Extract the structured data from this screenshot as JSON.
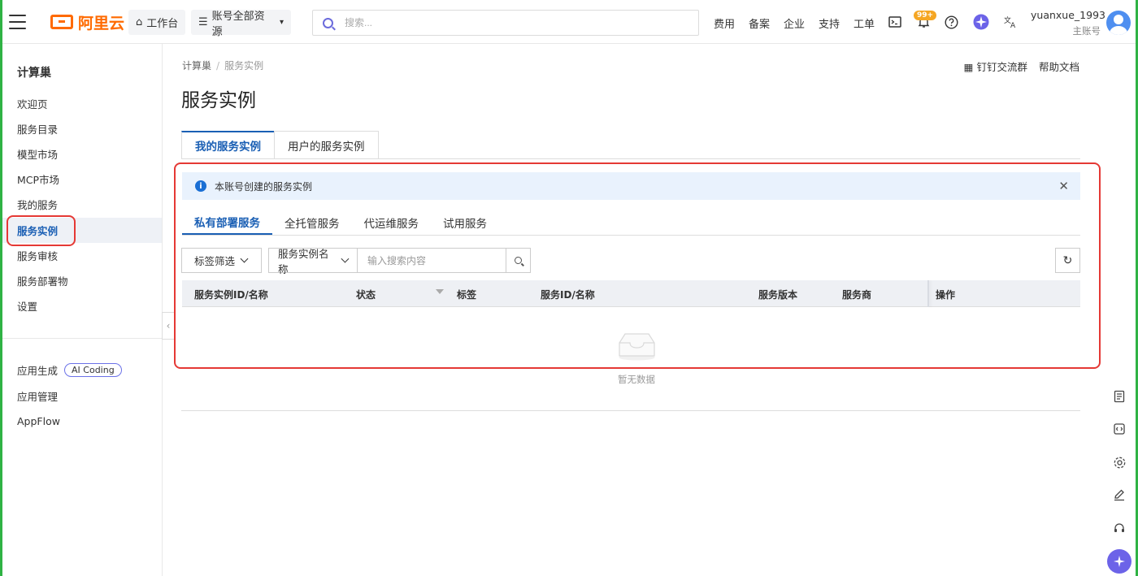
{
  "topbar": {
    "logo_text": "阿里云",
    "workbench_label": "工作台",
    "resource_label": "账号全部资源",
    "search_placeholder": "搜索...",
    "nav": [
      "费用",
      "备案",
      "企业",
      "支持",
      "工单"
    ],
    "notification_badge": "99+",
    "user_name": "yuanxue_1993",
    "user_role": "主账号"
  },
  "sidebar": {
    "title": "计算巢",
    "items": [
      "欢迎页",
      "服务目录",
      "模型市场",
      "MCP市场",
      "我的服务",
      "服务实例",
      "服务审核",
      "服务部署物",
      "设置"
    ],
    "active_item": "服务实例",
    "bottom_items": [
      "应用生成",
      "应用管理",
      "AppFlow"
    ],
    "ai_coding_tag": "AI Coding"
  },
  "breadcrumb": {
    "root": "计算巢",
    "current": "服务实例"
  },
  "header_links": {
    "dingtalk": "钉钉交流群",
    "help": "帮助文档"
  },
  "page": {
    "title": "服务实例",
    "main_tabs": [
      "我的服务实例",
      "用户的服务实例"
    ],
    "notice": "本账号创建的服务实例",
    "sub_tabs": [
      "私有部署服务",
      "全托管服务",
      "代运维服务",
      "试用服务"
    ],
    "filters": {
      "tag_filter": "标签筛选",
      "field_select": "服务实例名称",
      "keyword_placeholder": "输入搜索内容"
    },
    "columns": [
      "服务实例ID/名称",
      "状态",
      "标签",
      "服务ID/名称",
      "服务版本",
      "服务商",
      "操作"
    ],
    "empty_text": "暂无数据"
  },
  "colors": {
    "accent": "#1a5fb4",
    "brand": "#ff6a00",
    "annotation": "#e53935"
  }
}
